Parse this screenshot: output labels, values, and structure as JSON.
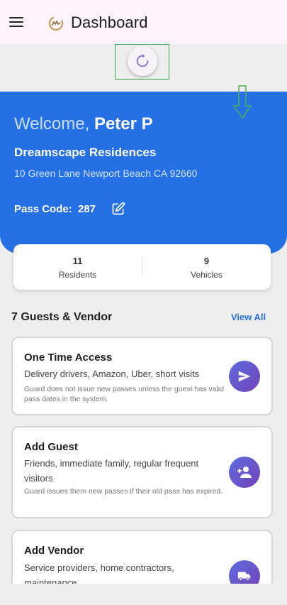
{
  "appbar": {
    "title": "Dashboard",
    "menu_icon": "menu-icon",
    "logo_icon": "community-logo-icon"
  },
  "refresh": {
    "icon": "refresh-icon"
  },
  "hero": {
    "welcome_prefix": "Welcome,",
    "user_name": "Peter P",
    "community_name": "Dreamscape Residences",
    "address": "10 Green Lane Newport Beach CA 92660",
    "pass_code_label": "Pass Code:",
    "pass_code_value": "287",
    "edit_icon": "edit-icon"
  },
  "stats": [
    {
      "value": "11",
      "label": "Residents"
    },
    {
      "value": "9",
      "label": "Vehicles"
    }
  ],
  "guests_section": {
    "title": "7 Guests & Vendor",
    "view_all_label": "View All"
  },
  "cards": [
    {
      "title": "One Time Access",
      "description": "Delivery drivers, Amazon, Uber, short visits",
      "note": "Guard does not issue new passes unless the guest has valid pass dates in the system.",
      "icon": "send-icon"
    },
    {
      "title": "Add Guest",
      "description": "Friends, immediate family, regular frequent visitors",
      "note": "Guard issues them new passes if their old pass has expired.",
      "icon": "add-person-icon"
    },
    {
      "title": "Add Vendor",
      "description": "Service providers, home contractors, maintenance",
      "note": "",
      "icon": "truck-icon"
    }
  ],
  "colors": {
    "primary": "#2670e6",
    "accent_gradient_start": "#5c6ee0",
    "accent_gradient_end": "#7440b8",
    "appbar_bg": "#fdf4fb"
  }
}
